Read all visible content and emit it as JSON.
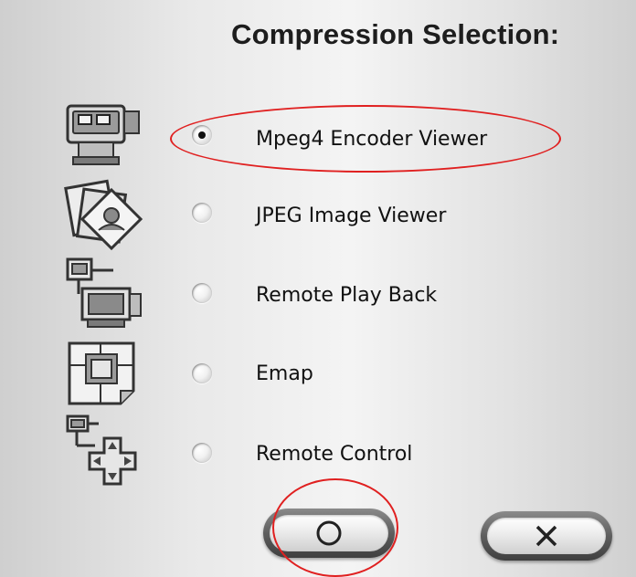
{
  "dialog": {
    "title": "Compression Selection:"
  },
  "options": [
    {
      "label": "Mpeg4 Encoder Viewer",
      "icon": "video-camera-icon",
      "selected": true
    },
    {
      "label": "JPEG Image Viewer",
      "icon": "image-stack-icon",
      "selected": false
    },
    {
      "label": "Remote Play Back",
      "icon": "remote-computer-icon",
      "selected": false
    },
    {
      "label": "Emap",
      "icon": "floor-map-icon",
      "selected": false
    },
    {
      "label": "Remote Control",
      "icon": "remote-control-dpad-icon",
      "selected": false
    }
  ],
  "buttons": {
    "ok": {
      "icon": "circle-o-icon"
    },
    "cancel": {
      "icon": "x-icon"
    }
  },
  "colors": {
    "annotation": "#e02020",
    "text": "#111111"
  }
}
